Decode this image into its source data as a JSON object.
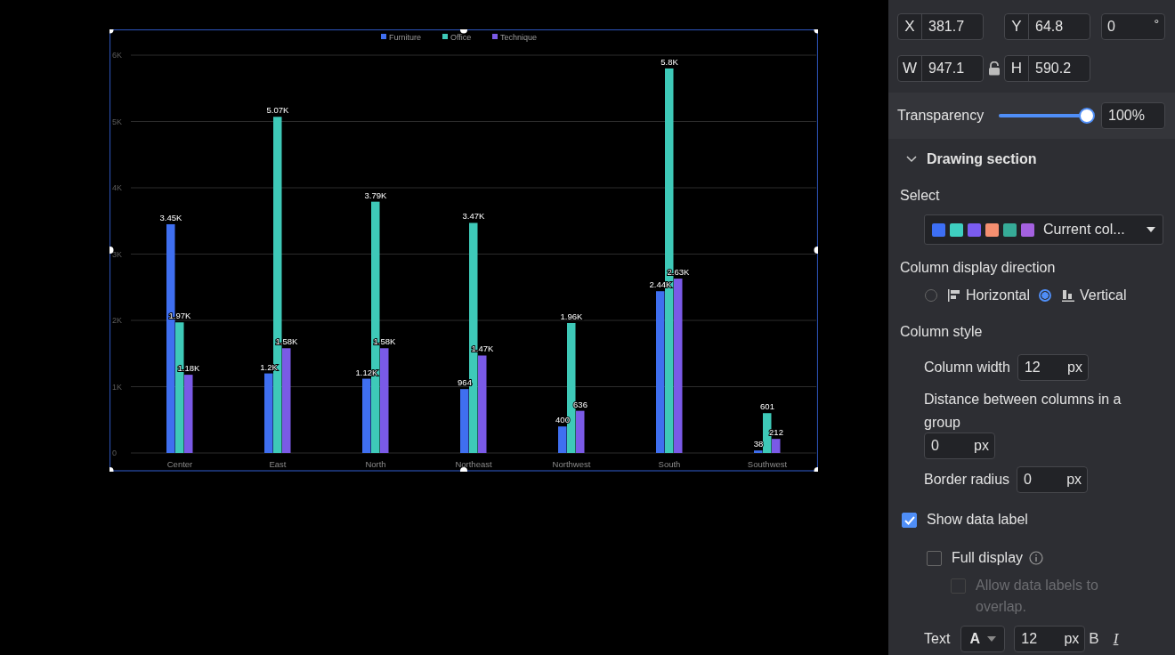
{
  "chart": {
    "chart_data": {
      "type": "bar",
      "orientation": "vertical",
      "categories": [
        "Center",
        "East",
        "North",
        "Northeast",
        "Northwest",
        "South",
        "Southwest"
      ],
      "series": [
        {
          "name": "Furniture",
          "color": "#3f6ff0",
          "values": [
            3450,
            1200,
            1120,
            964,
            400,
            2440,
            38
          ]
        },
        {
          "name": "Office",
          "color": "#3ec9b8",
          "values": [
            1970,
            5070,
            3790,
            3470,
            1960,
            5800,
            601
          ]
        },
        {
          "name": "Technique",
          "color": "#7a5ae6",
          "values": [
            1180,
            1580,
            1580,
            1470,
            636,
            2630,
            212
          ]
        }
      ],
      "ylim": [
        0,
        6000
      ],
      "yticks": [
        {
          "value": 0,
          "label": "0"
        },
        {
          "value": 1000,
          "label": "1K"
        },
        {
          "value": 2000,
          "label": "2K"
        },
        {
          "value": 3000,
          "label": "3K"
        },
        {
          "value": 4000,
          "label": "4K"
        },
        {
          "value": 5000,
          "label": "5K"
        },
        {
          "value": 6000,
          "label": "6K"
        }
      ],
      "grid": true,
      "legend": "top",
      "value_labels": [
        [
          "3.45K",
          "1.2K",
          "1.12K",
          "964",
          "400",
          "2.44K",
          "38"
        ],
        [
          "1.97K",
          "5.07K",
          "3.79K",
          "3.47K",
          "1.96K",
          "5.8K",
          "601"
        ],
        [
          "1.18K",
          "1.58K",
          "1.58K",
          "1.47K",
          "636",
          "2.63K",
          "212"
        ]
      ]
    }
  },
  "position_fields": [
    {
      "label": "X",
      "value": "381.7"
    },
    {
      "label": "Y",
      "value": "64.8"
    }
  ],
  "rotation": {
    "value": "0",
    "unit": "°"
  },
  "size_fields": [
    {
      "label": "W",
      "value": "947.1"
    },
    {
      "label": "H",
      "value": "590.2"
    }
  ],
  "transparency": {
    "label": "Transparency",
    "level": 1,
    "value": "100%"
  },
  "drawing_section": {
    "title": "Drawing section",
    "expanded": true
  },
  "select": {
    "label": "Select",
    "value": "Current col...",
    "swatches": [
      {
        "color": "#3d6ff5"
      },
      {
        "color": "#3ecfc0"
      },
      {
        "color": "#7b5cf0"
      },
      {
        "color": "#f58f70"
      },
      {
        "color": "#36ab97"
      },
      {
        "color": "#a461e0"
      }
    ]
  },
  "direction": {
    "label": "Column display direction",
    "options": [
      {
        "label": "Horizontal",
        "kind": "horizontal",
        "selected": false
      },
      {
        "label": "Vertical",
        "kind": "vertical",
        "selected": true
      }
    ]
  },
  "column_style": {
    "label": "Column style",
    "fields": [
      {
        "label": "Column width",
        "value": "12",
        "unit": "px",
        "kind": "inline"
      },
      {
        "label": "Distance between columns in a group",
        "value": "0",
        "unit": "px",
        "kind": "stacked"
      },
      {
        "label": "Border radius",
        "value": "0",
        "unit": "px",
        "kind": "inline"
      }
    ]
  },
  "data_label": {
    "label": "Show data label",
    "checked": true,
    "disabled": false,
    "info": false,
    "children": [
      {
        "label": "Full display",
        "checked": false,
        "disabled": false,
        "info": true,
        "children": [
          {
            "label": "Allow data labels to overlap.",
            "checked": false,
            "disabled": true,
            "info": false
          }
        ]
      }
    ]
  },
  "text_style": {
    "label": "Text",
    "font_button": "A",
    "size": "12",
    "unit": "px",
    "bold": "B",
    "italic": "I"
  }
}
